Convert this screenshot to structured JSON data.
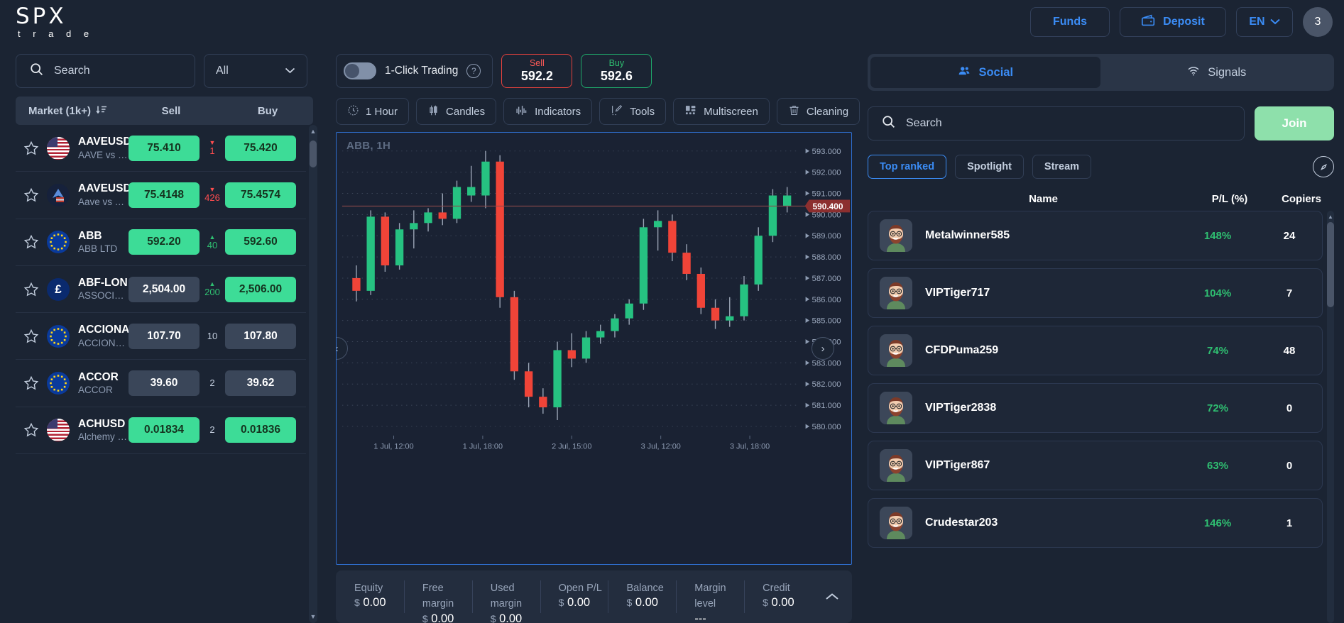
{
  "header": {
    "logo_main": "SPX",
    "logo_sub": "t r a d e",
    "funds_label": "Funds",
    "deposit_label": "Deposit",
    "language": "EN",
    "avatar_count": "3"
  },
  "market_panel": {
    "search_placeholder": "Search",
    "filter_value": "All",
    "columns": {
      "name": "Market (1k+)",
      "sell": "Sell",
      "buy": "Buy"
    },
    "rows": [
      {
        "symbol": "AAVEUSD.",
        "desc": "AAVE vs USD",
        "flag": "us",
        "sell": "75.410",
        "sell_state": "up",
        "buy": "75.420",
        "buy_state": "up",
        "spread": "1",
        "spread_dir": "down"
      },
      {
        "symbol": "AAVEUSDT.",
        "desc": "Aave vs Tether",
        "flag": "crypto",
        "sell": "75.4148",
        "sell_state": "up",
        "buy": "75.4574",
        "buy_state": "up",
        "spread": "426",
        "spread_dir": "down"
      },
      {
        "symbol": "ABB",
        "desc": "ABB LTD",
        "flag": "eu",
        "sell": "592.20",
        "sell_state": "up",
        "buy": "592.60",
        "buy_state": "up",
        "spread": "40",
        "spread_dir": "up"
      },
      {
        "symbol": "ABF-LON",
        "desc": "ASSOCIATED...",
        "flag": "gb",
        "sell": "2,504.00",
        "sell_state": "flat",
        "buy": "2,506.00",
        "buy_state": "up",
        "spread": "200",
        "spread_dir": "up"
      },
      {
        "symbol": "ACCIONA",
        "desc": "ACCIONA S.A.",
        "flag": "eu",
        "sell": "107.70",
        "sell_state": "flat",
        "buy": "107.80",
        "buy_state": "flat",
        "spread": "10",
        "spread_dir": "none"
      },
      {
        "symbol": "ACCOR",
        "desc": "ACCOR",
        "flag": "eu",
        "sell": "39.60",
        "sell_state": "flat",
        "buy": "39.62",
        "buy_state": "flat",
        "spread": "2",
        "spread_dir": "none"
      },
      {
        "symbol": "ACHUSD",
        "desc": "Alchemy Pay ...",
        "flag": "us",
        "sell": "0.01834",
        "sell_state": "up",
        "buy": "0.01836",
        "buy_state": "up",
        "spread": "2",
        "spread_dir": "none"
      }
    ]
  },
  "trade_bar": {
    "one_click_label": "1-Click Trading",
    "help_glyph": "?",
    "sell_label": "Sell",
    "sell_price": "592.2",
    "buy_label": "Buy",
    "buy_price": "592.6"
  },
  "chart_tools": [
    {
      "label": "1 Hour",
      "icon": "clock-icon"
    },
    {
      "label": "Candles",
      "icon": "candles-icon"
    },
    {
      "label": "Indicators",
      "icon": "indicators-icon"
    },
    {
      "label": "Tools",
      "icon": "tools-icon"
    },
    {
      "label": "Multiscreen",
      "icon": "multiscreen-icon"
    },
    {
      "label": "Cleaning",
      "icon": "trash-icon"
    }
  ],
  "account": {
    "cells": [
      {
        "label": "Equity",
        "currency": "$",
        "value": "0.00"
      },
      {
        "label": "Free margin",
        "currency": "$",
        "value": "0.00"
      },
      {
        "label": "Used margin",
        "currency": "$",
        "value": "0.00"
      },
      {
        "label": "Open P/L",
        "currency": "$",
        "value": "0.00"
      },
      {
        "label": "Balance",
        "currency": "$",
        "value": "0.00"
      },
      {
        "label": "Margin level",
        "currency": "",
        "value": "---"
      },
      {
        "label": "Credit",
        "currency": "$",
        "value": "0.00"
      }
    ]
  },
  "social": {
    "tabs": [
      {
        "label": "Social",
        "icon": "people-icon",
        "active": true
      },
      {
        "label": "Signals",
        "icon": "wifi-icon",
        "active": false
      }
    ],
    "search_placeholder": "Search",
    "join_label": "Join",
    "chips": [
      {
        "label": "Top ranked",
        "active": true
      },
      {
        "label": "Spotlight",
        "active": false
      },
      {
        "label": "Stream",
        "active": false
      }
    ],
    "columns": {
      "name": "Name",
      "pl": "P/L (%)",
      "copiers": "Copiers"
    },
    "traders": [
      {
        "name": "Metalwinner585",
        "pl": "148%",
        "copiers": "24"
      },
      {
        "name": "VIPTiger717",
        "pl": "104%",
        "copiers": "7"
      },
      {
        "name": "CFDPuma259",
        "pl": "74%",
        "copiers": "48"
      },
      {
        "name": "VIPTiger2838",
        "pl": "72%",
        "copiers": "0"
      },
      {
        "name": "VIPTiger867",
        "pl": "63%",
        "copiers": "0"
      },
      {
        "name": "Crudestar203",
        "pl": "146%",
        "copiers": "1"
      }
    ]
  },
  "chart_data": {
    "type": "candlestick",
    "title": "ABB, 1H",
    "symbol": "ABB",
    "timeframe": "1H",
    "ylabel": "",
    "xlabel": "",
    "ylim": [
      579.6,
      593.4
    ],
    "y_ticks": [
      "593.000",
      "592.000",
      "591.000",
      "590.000",
      "589.000",
      "588.000",
      "587.000",
      "586.000",
      "585.000",
      "584.000",
      "583.000",
      "582.000",
      "581.000",
      "580.000"
    ],
    "x_ticks": [
      "1 Jul, 12:00",
      "1 Jul, 18:00",
      "2 Jul, 15:00",
      "3 Jul, 12:00",
      "3 Jul, 18:00"
    ],
    "current_price": "590.400",
    "current_price_value": 590.4,
    "grid": "dotted",
    "colors": {
      "up": "#26c281",
      "down": "#f04438",
      "wick": "#9aa4b5",
      "price_line": "#8b4a4a"
    },
    "candles": [
      {
        "o": 587.0,
        "h": 587.6,
        "l": 585.9,
        "c": 586.4,
        "d": "down"
      },
      {
        "o": 586.4,
        "h": 590.2,
        "l": 586.2,
        "c": 589.9,
        "d": "up"
      },
      {
        "o": 589.9,
        "h": 590.1,
        "l": 587.3,
        "c": 587.6,
        "d": "down"
      },
      {
        "o": 587.6,
        "h": 589.6,
        "l": 587.4,
        "c": 589.3,
        "d": "up"
      },
      {
        "o": 589.3,
        "h": 590.2,
        "l": 588.4,
        "c": 589.6,
        "d": "up"
      },
      {
        "o": 589.6,
        "h": 590.3,
        "l": 589.2,
        "c": 590.1,
        "d": "up"
      },
      {
        "o": 590.1,
        "h": 591.0,
        "l": 589.5,
        "c": 589.8,
        "d": "down"
      },
      {
        "o": 589.8,
        "h": 591.6,
        "l": 589.6,
        "c": 591.3,
        "d": "up"
      },
      {
        "o": 591.3,
        "h": 592.3,
        "l": 590.6,
        "c": 590.9,
        "d": "up"
      },
      {
        "o": 590.9,
        "h": 593.0,
        "l": 590.3,
        "c": 592.5,
        "d": "up"
      },
      {
        "o": 592.5,
        "h": 592.8,
        "l": 585.6,
        "c": 586.1,
        "d": "down"
      },
      {
        "o": 586.1,
        "h": 586.4,
        "l": 582.2,
        "c": 582.6,
        "d": "down"
      },
      {
        "o": 582.6,
        "h": 583.0,
        "l": 580.9,
        "c": 581.4,
        "d": "down"
      },
      {
        "o": 581.4,
        "h": 581.8,
        "l": 580.6,
        "c": 580.9,
        "d": "down"
      },
      {
        "o": 580.9,
        "h": 584.0,
        "l": 580.3,
        "c": 583.6,
        "d": "up"
      },
      {
        "o": 583.6,
        "h": 584.4,
        "l": 582.8,
        "c": 583.2,
        "d": "down"
      },
      {
        "o": 583.2,
        "h": 584.5,
        "l": 583.0,
        "c": 584.2,
        "d": "up"
      },
      {
        "o": 584.2,
        "h": 584.8,
        "l": 583.9,
        "c": 584.5,
        "d": "up"
      },
      {
        "o": 584.5,
        "h": 585.3,
        "l": 584.2,
        "c": 585.1,
        "d": "up"
      },
      {
        "o": 585.1,
        "h": 586.0,
        "l": 584.8,
        "c": 585.8,
        "d": "up"
      },
      {
        "o": 585.8,
        "h": 589.8,
        "l": 585.5,
        "c": 589.4,
        "d": "up"
      },
      {
        "o": 589.4,
        "h": 590.2,
        "l": 588.3,
        "c": 589.7,
        "d": "up"
      },
      {
        "o": 589.7,
        "h": 590.0,
        "l": 587.8,
        "c": 588.2,
        "d": "down"
      },
      {
        "o": 588.2,
        "h": 588.6,
        "l": 586.9,
        "c": 587.2,
        "d": "down"
      },
      {
        "o": 587.2,
        "h": 587.5,
        "l": 585.3,
        "c": 585.6,
        "d": "down"
      },
      {
        "o": 585.6,
        "h": 586.0,
        "l": 584.6,
        "c": 585.0,
        "d": "down"
      },
      {
        "o": 585.0,
        "h": 586.1,
        "l": 584.7,
        "c": 585.2,
        "d": "up"
      },
      {
        "o": 585.2,
        "h": 587.1,
        "l": 585.0,
        "c": 586.7,
        "d": "up"
      },
      {
        "o": 586.7,
        "h": 589.4,
        "l": 586.4,
        "c": 589.0,
        "d": "up"
      },
      {
        "o": 589.0,
        "h": 591.2,
        "l": 588.7,
        "c": 590.9,
        "d": "up"
      },
      {
        "o": 590.9,
        "h": 591.3,
        "l": 590.1,
        "c": 590.4,
        "d": "up"
      }
    ]
  }
}
